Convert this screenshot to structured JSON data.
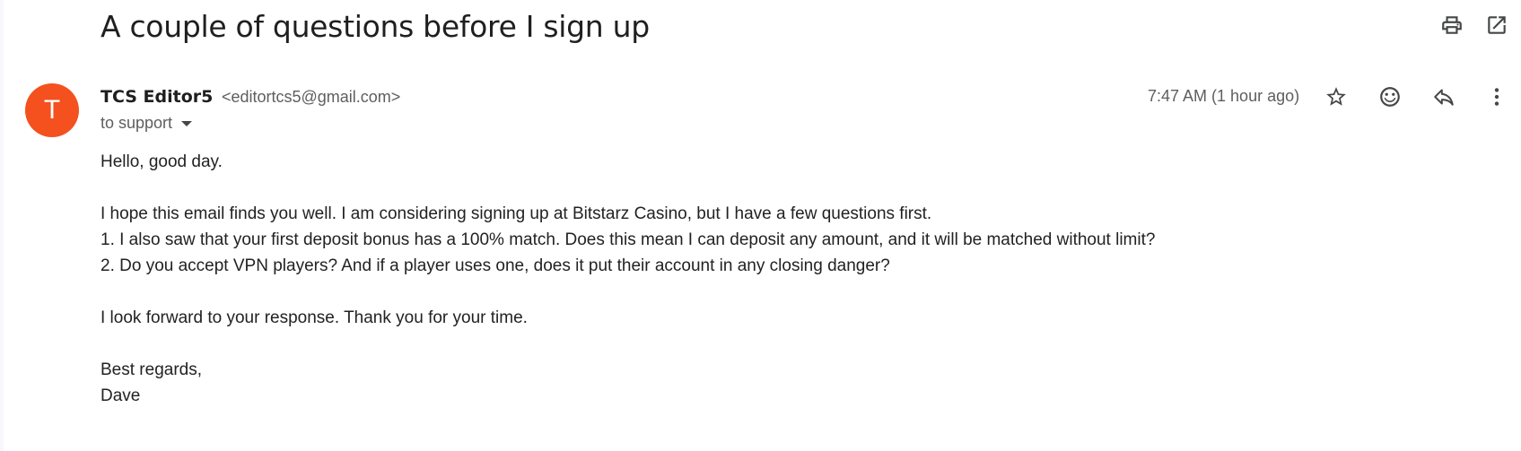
{
  "email": {
    "subject": "A couple of questions before I sign up",
    "sender": {
      "avatar_letter": "T",
      "avatar_color": "#f4511e",
      "name": "TCS Editor5",
      "email": "<editortcs5@gmail.com>"
    },
    "recipient_label": "to support",
    "timestamp": "7:47 AM (1 hour ago)",
    "body": {
      "greeting": "Hello, good day.",
      "intro": "I hope this email finds you well. I am considering signing up at Bitstarz Casino, but I have a few questions first.",
      "question_1": "1. I also saw that your first deposit bonus has a 100% match. Does this mean I can deposit any amount, and it will be matched without limit?",
      "question_2": "2. Do you accept VPN players? And if a player uses one, does it put their account in any closing danger?",
      "closing": "I look forward to your response. Thank you for your time.",
      "signoff": "Best regards,",
      "signature": "Dave"
    }
  },
  "toolbar": {
    "icons": [
      "print-icon",
      "open-in-new-window-icon"
    ]
  },
  "message_actions": {
    "icons": [
      "star-icon",
      "emoji-reaction-icon",
      "reply-icon",
      "more-options-icon"
    ]
  }
}
